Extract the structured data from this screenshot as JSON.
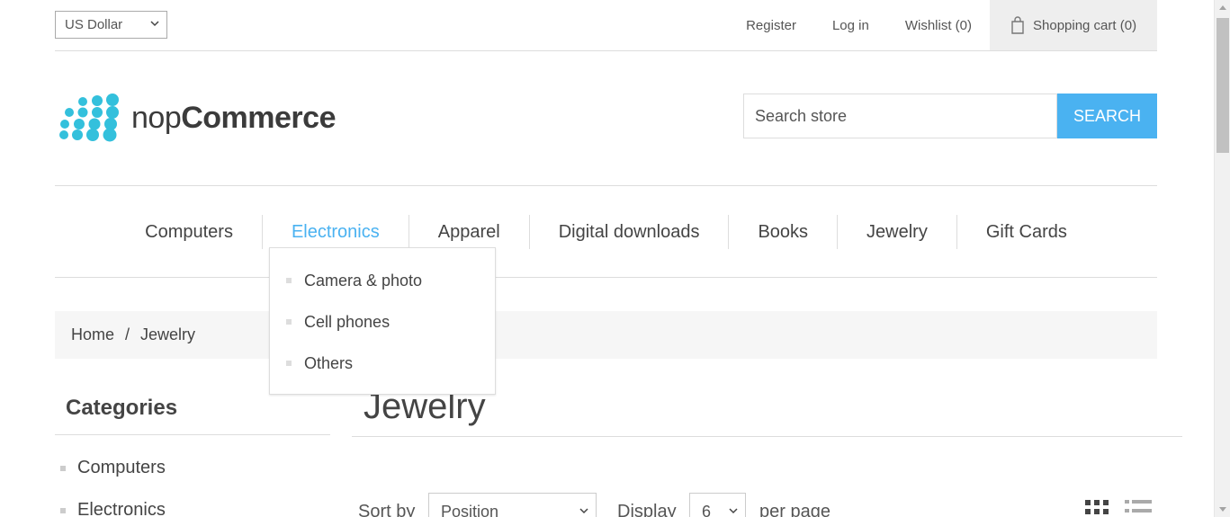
{
  "header": {
    "currency": "US Dollar",
    "links": {
      "register": "Register",
      "login": "Log in",
      "wishlist": "Wishlist (0)",
      "cart": "Shopping cart (0)"
    }
  },
  "logo": {
    "text_light": "nop",
    "text_bold": "Commerce",
    "color": "#33c0dc"
  },
  "search": {
    "placeholder": "Search store",
    "button": "SEARCH",
    "button_color": "#4ab2f1"
  },
  "menu": {
    "items": [
      "Computers",
      "Electronics",
      "Apparel",
      "Digital downloads",
      "Books",
      "Jewelry",
      "Gift Cards"
    ],
    "active": "Electronics",
    "dropdown": [
      "Camera & photo",
      "Cell phones",
      "Others"
    ]
  },
  "breadcrumb": {
    "home": "Home",
    "separator": "/",
    "current": "Jewelry"
  },
  "sidebar": {
    "title": "Categories",
    "items": [
      "Computers",
      "Electronics"
    ]
  },
  "main": {
    "title": "Jewelry",
    "sort_label": "Sort by",
    "sort_value": "Position",
    "display_label": "Display",
    "display_value": "6",
    "per_page_label": "per page"
  },
  "accent_color": "#4ab2f1"
}
